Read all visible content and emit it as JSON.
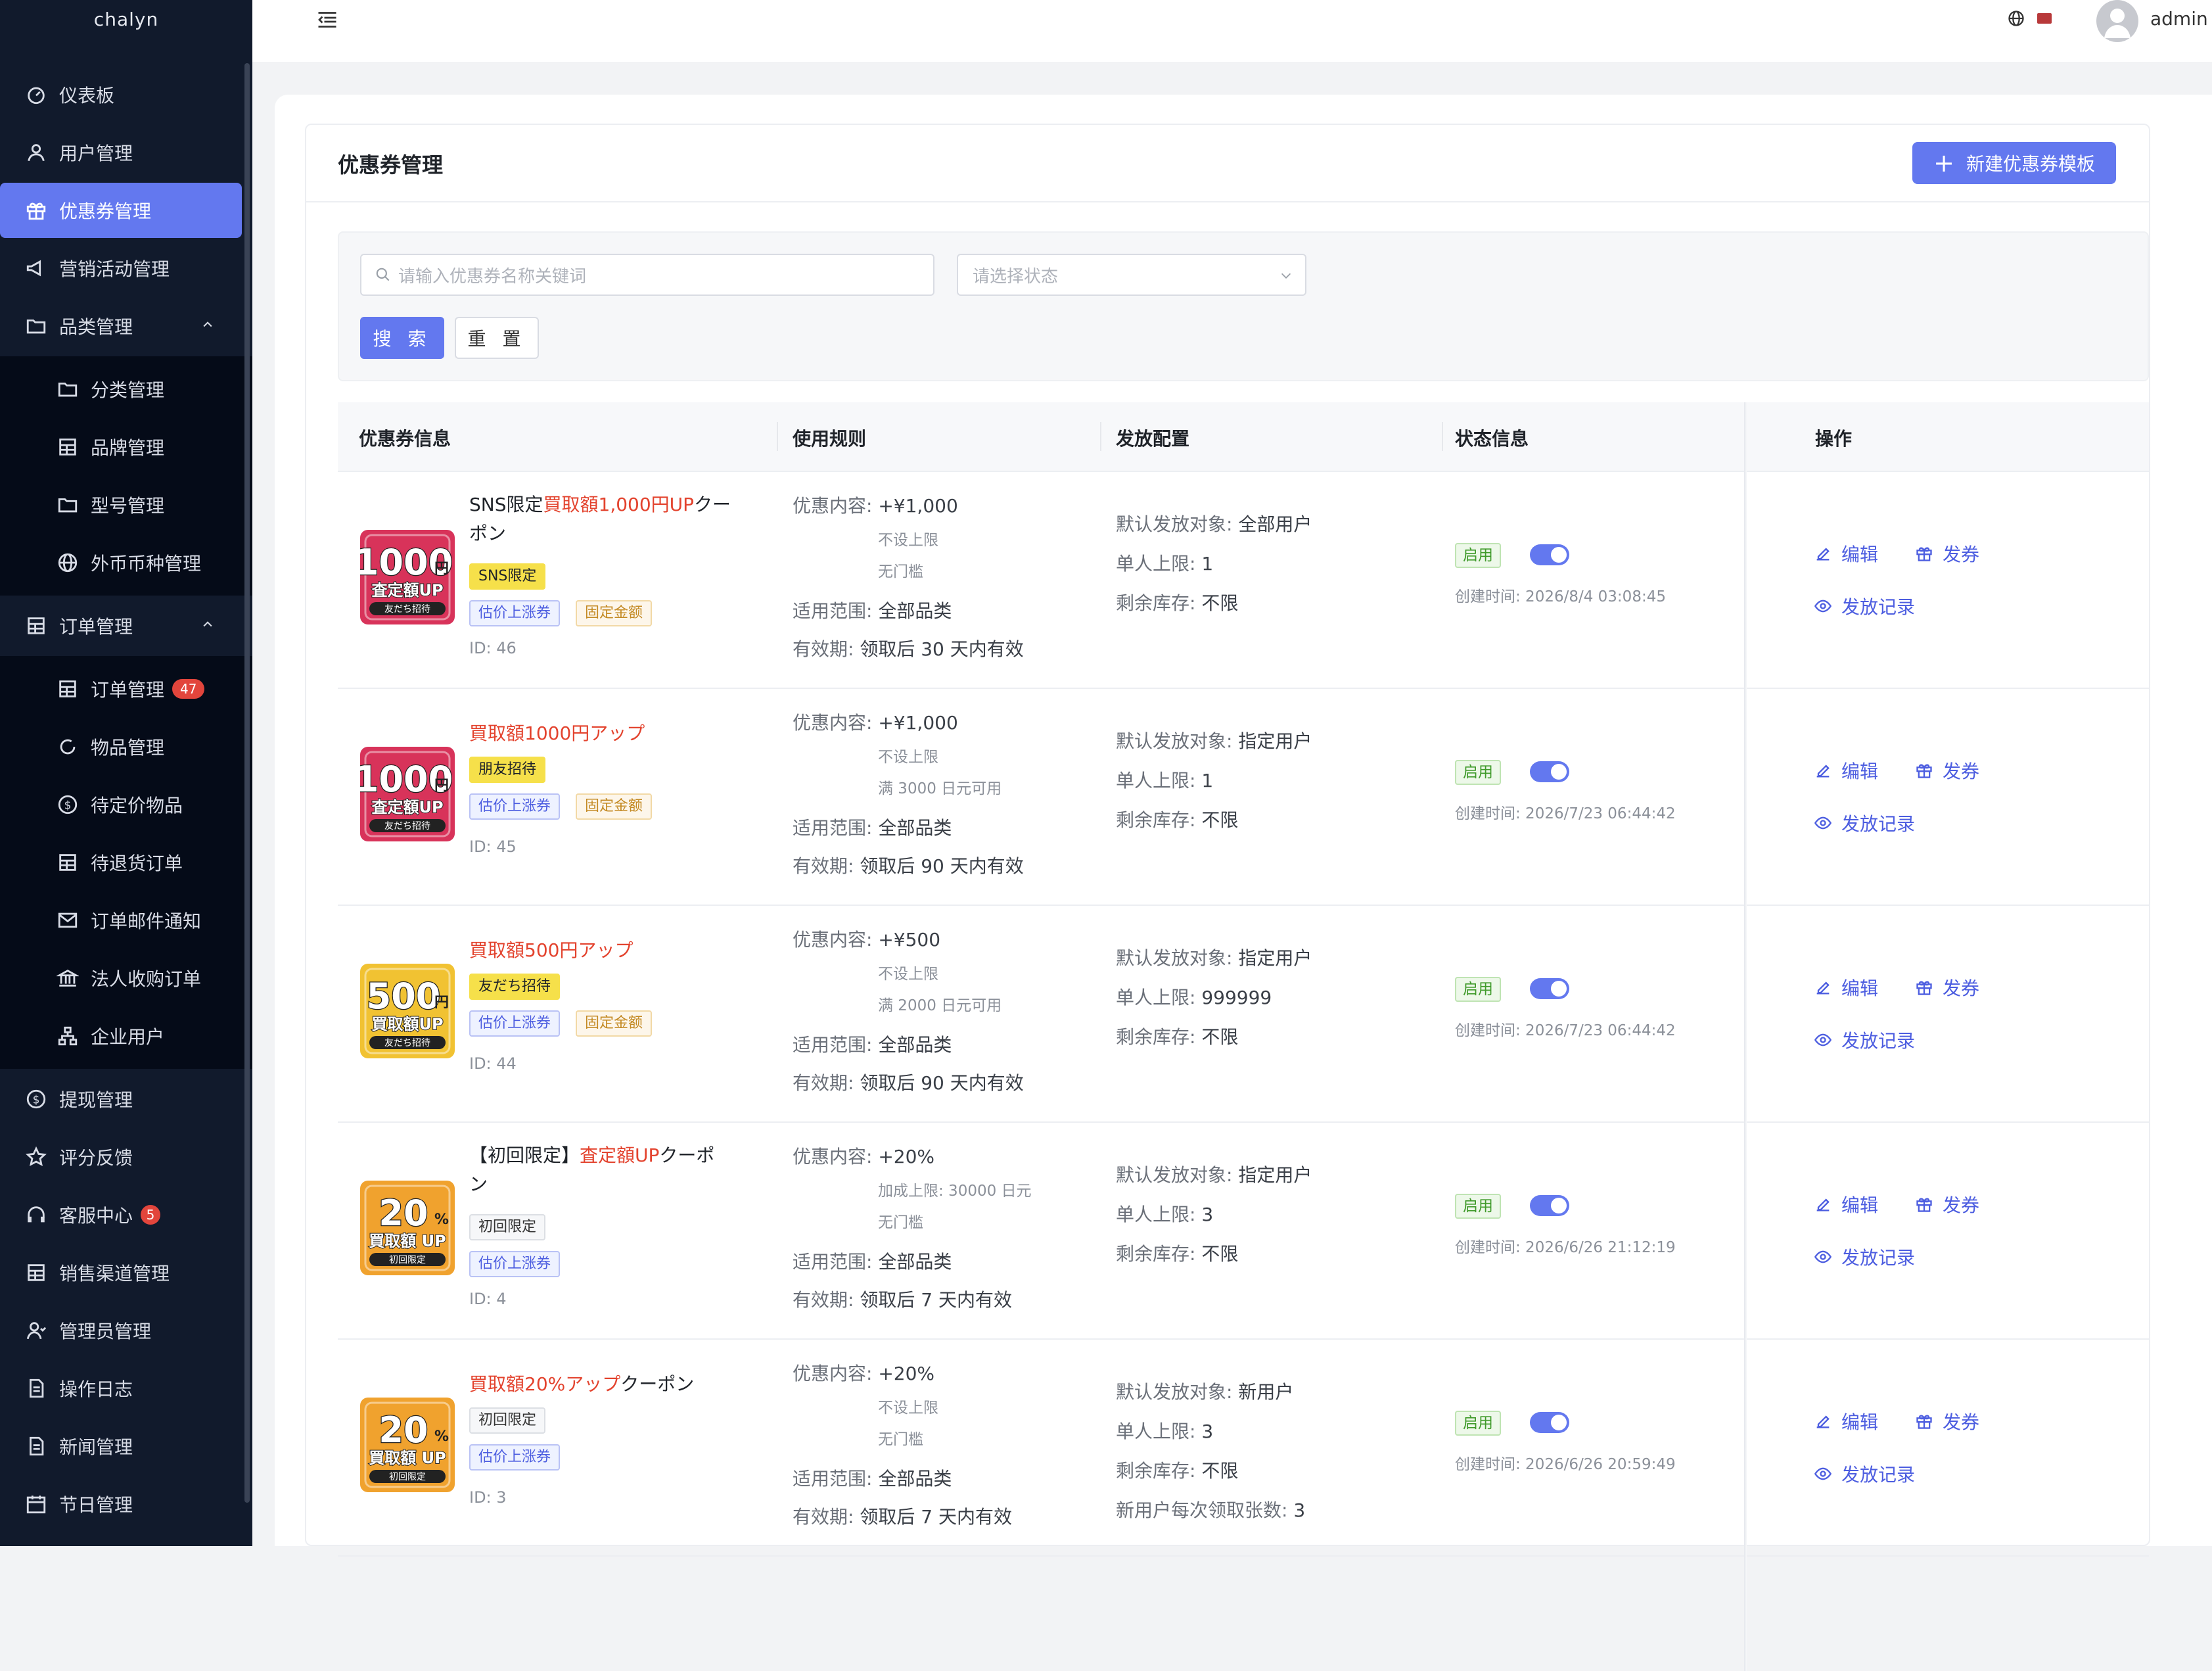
{
  "app": {
    "brand": "chalyn"
  },
  "sidebar": {
    "items": [
      {
        "label": "仪表板",
        "icon": "dashboard-icon"
      },
      {
        "label": "用户管理",
        "icon": "user-icon"
      },
      {
        "label": "优惠券管理",
        "icon": "gift-icon",
        "active": true
      },
      {
        "label": "营销活动管理",
        "icon": "megaphone-icon"
      },
      {
        "label": "品类管理",
        "icon": "folder-icon",
        "expanded": true
      }
    ],
    "category_sub": [
      {
        "label": "分类管理",
        "icon": "folder-icon"
      },
      {
        "label": "品牌管理",
        "icon": "table-icon"
      },
      {
        "label": "型号管理",
        "icon": "folder-icon"
      },
      {
        "label": "外币币种管理",
        "icon": "globe-icon"
      }
    ],
    "order_group": {
      "label": "订单管理",
      "icon": "table-icon"
    },
    "order_sub": [
      {
        "label": "订单管理",
        "icon": "table-icon",
        "badge": "47"
      },
      {
        "label": "物品管理",
        "icon": "refresh-icon"
      },
      {
        "label": "待定价物品",
        "icon": "dollar-circle-icon"
      },
      {
        "label": "待退货订单",
        "icon": "table-icon"
      },
      {
        "label": "订单邮件通知",
        "icon": "mail-icon"
      },
      {
        "label": "法人收购订单",
        "icon": "bank-icon"
      },
      {
        "label": "企业用户",
        "icon": "org-icon"
      }
    ],
    "bottom_items": [
      {
        "label": "提现管理",
        "icon": "dollar-circle-icon"
      },
      {
        "label": "评分反馈",
        "icon": "star-icon"
      },
      {
        "label": "客服中心",
        "icon": "headset-icon",
        "badge": "5"
      },
      {
        "label": "销售渠道管理",
        "icon": "table-icon"
      },
      {
        "label": "管理员管理",
        "icon": "admin-icon"
      },
      {
        "label": "操作日志",
        "icon": "file-icon"
      },
      {
        "label": "新闻管理",
        "icon": "file-icon"
      },
      {
        "label": "节日管理",
        "icon": "calendar-icon"
      }
    ]
  },
  "header": {
    "username": "admin"
  },
  "page": {
    "title": "优惠券管理",
    "new_button": "新建优惠券模板",
    "search_placeholder": "请输入优惠券名称关键词",
    "status_placeholder": "请选择状态",
    "search_button": "搜 索",
    "reset_button": "重 置"
  },
  "table": {
    "columns": [
      "优惠券信息",
      "使用规则",
      "发放配置",
      "状态信息",
      "操作"
    ],
    "actions": {
      "edit": "编辑",
      "issue": "发券",
      "records": "发放记录"
    },
    "rows": [
      {
        "name_black": "SNS限定",
        "name_red": "買取額1,000円UP",
        "name_tail": "クーポン",
        "thumb": {
          "big": "1000",
          "unit": "円",
          "line": "査定額UP",
          "sub": "友だち招待",
          "color": "#d8335a"
        },
        "tags": [
          {
            "t": "SNS限定",
            "c": "yellow"
          },
          {
            "t": "估价上涨券",
            "c": "blue"
          },
          {
            "t": "固定金额",
            "c": "gold"
          }
        ],
        "id": "ID: 46",
        "rule_content_k": "优惠内容:",
        "rule_content_v": "+¥1,000",
        "rule_sub1": "不设上限",
        "rule_sub2": "无门槛",
        "scope_k": "适用范围:",
        "scope_v": "全部品类",
        "valid_k": "有效期:",
        "valid_v": "领取后 30 天内有效",
        "dist": [
          {
            "k": "默认发放对象:",
            "v": "全部用户"
          },
          {
            "k": "单人上限:",
            "v": "1"
          },
          {
            "k": "剩余库存:",
            "v": "不限"
          }
        ],
        "status": "启用",
        "created": "创建时间: 2026/8/4 03:08:45"
      },
      {
        "name_black": "",
        "name_red": "買取額1000円アップ",
        "name_tail": "",
        "thumb": {
          "big": "1000",
          "unit": "円",
          "line": "査定額UP",
          "sub": "友だち招待",
          "color": "#d8335a"
        },
        "tags": [
          {
            "t": "朋友招待",
            "c": "yellow"
          },
          {
            "t": "估价上涨券",
            "c": "blue"
          },
          {
            "t": "固定金额",
            "c": "gold"
          }
        ],
        "id": "ID: 45",
        "rule_content_k": "优惠内容:",
        "rule_content_v": "+¥1,000",
        "rule_sub1": "不设上限",
        "rule_sub2": "满 3000 日元可用",
        "scope_k": "适用范围:",
        "scope_v": "全部品类",
        "valid_k": "有效期:",
        "valid_v": "领取后 90 天内有效",
        "dist": [
          {
            "k": "默认发放对象:",
            "v": "指定用户"
          },
          {
            "k": "单人上限:",
            "v": "1"
          },
          {
            "k": "剩余库存:",
            "v": "不限"
          }
        ],
        "status": "启用",
        "created": "创建时间: 2026/7/23 06:44:42"
      },
      {
        "name_black": "",
        "name_red": "買取額500円アップ",
        "name_tail": "",
        "thumb": {
          "big": "500",
          "unit": "円",
          "line": "買取額UP",
          "sub": "友だち招待",
          "color": "#f1c232"
        },
        "tags": [
          {
            "t": "友だち招待",
            "c": "yellow"
          },
          {
            "t": "估价上涨券",
            "c": "blue"
          },
          {
            "t": "固定金额",
            "c": "gold"
          }
        ],
        "id": "ID: 44",
        "rule_content_k": "优惠内容:",
        "rule_content_v": "+¥500",
        "rule_sub1": "不设上限",
        "rule_sub2": "满 2000 日元可用",
        "scope_k": "适用范围:",
        "scope_v": "全部品类",
        "valid_k": "有效期:",
        "valid_v": "领取后 90 天内有效",
        "dist": [
          {
            "k": "默认发放对象:",
            "v": "指定用户"
          },
          {
            "k": "单人上限:",
            "v": "999999"
          },
          {
            "k": "剩余库存:",
            "v": "不限"
          }
        ],
        "status": "启用",
        "created": "创建时间: 2026/7/23 06:44:42"
      },
      {
        "name_black": "【初回限定】",
        "name_red": "査定額UP",
        "name_tail": "クーポン",
        "thumb": {
          "big": "20",
          "unit": "%",
          "line": "買取額 UP",
          "sub": "初回限定",
          "color": "#f0a22e"
        },
        "tags": [
          {
            "t": "初回限定",
            "c": "plain"
          },
          {
            "t": "估价上涨券",
            "c": "blue"
          }
        ],
        "id": "ID: 4",
        "rule_content_k": "优惠内容:",
        "rule_content_v": "+20%",
        "rule_sub1": "加成上限: 30000 日元",
        "rule_sub2": "无门槛",
        "scope_k": "适用范围:",
        "scope_v": "全部品类",
        "valid_k": "有效期:",
        "valid_v": "领取后 7 天内有效",
        "dist": [
          {
            "k": "默认发放对象:",
            "v": "指定用户"
          },
          {
            "k": "单人上限:",
            "v": "3"
          },
          {
            "k": "剩余库存:",
            "v": "不限"
          }
        ],
        "status": "启用",
        "created": "创建时间: 2026/6/26 21:12:19"
      },
      {
        "name_black": "",
        "name_red": "買取額20%アップ",
        "name_tail": "クーポン",
        "thumb": {
          "big": "20",
          "unit": "%",
          "line": "買取額 UP",
          "sub": "初回限定",
          "color": "#f0a22e"
        },
        "tags": [
          {
            "t": "初回限定",
            "c": "plain"
          },
          {
            "t": "估价上涨券",
            "c": "blue"
          }
        ],
        "id": "ID: 3",
        "rule_content_k": "优惠内容:",
        "rule_content_v": "+20%",
        "rule_sub1": "不设上限",
        "rule_sub2": "无门槛",
        "scope_k": "适用范围:",
        "scope_v": "全部品类",
        "valid_k": "有效期:",
        "valid_v": "领取后 7 天内有效",
        "dist": [
          {
            "k": "默认发放对象:",
            "v": "新用户"
          },
          {
            "k": "单人上限:",
            "v": "3"
          },
          {
            "k": "剩余库存:",
            "v": "不限"
          },
          {
            "k": "新用户每次领取张数:",
            "v": "3"
          }
        ],
        "status": "启用",
        "created": "创建时间: 2026/6/26 20:59:49"
      }
    ]
  }
}
